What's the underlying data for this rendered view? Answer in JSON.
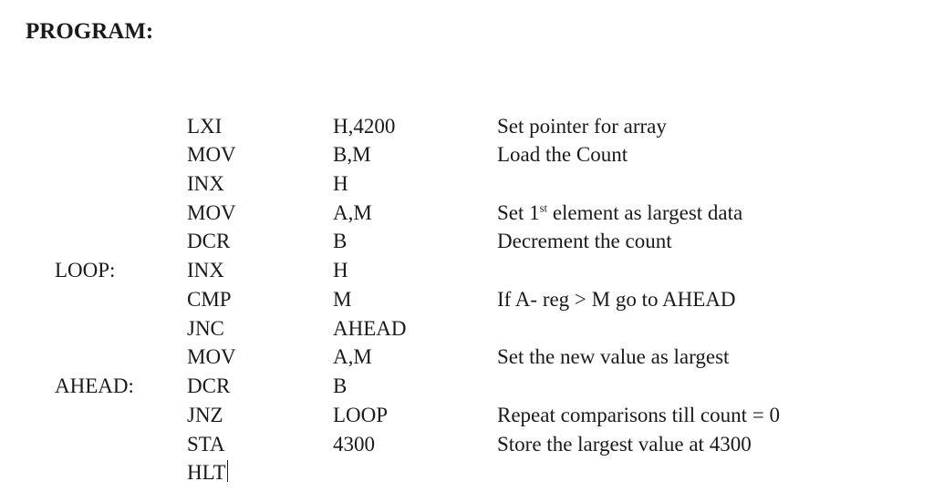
{
  "heading": "PROGRAM:",
  "program": {
    "rows": [
      {
        "label": "",
        "mnemonic": "LXI",
        "operand": "H,4200",
        "comment": "Set pointer for array"
      },
      {
        "label": "",
        "mnemonic": "MOV",
        "operand": "B,M",
        "comment": "Load the Count"
      },
      {
        "label": "",
        "mnemonic": "INX",
        "operand": "H",
        "comment": ""
      },
      {
        "label": "",
        "mnemonic": "MOV",
        "operand": "A,M",
        "comment_html": "Set 1<sup>st</sup> element as largest data"
      },
      {
        "label": "",
        "mnemonic": "DCR",
        "operand": "B",
        "comment": "Decrement the count"
      },
      {
        "label": "LOOP:",
        "mnemonic": "INX",
        "operand": "H",
        "comment": ""
      },
      {
        "label": "",
        "mnemonic": "CMP",
        "operand": "M",
        "comment": "If A- reg > M go to AHEAD"
      },
      {
        "label": "",
        "mnemonic": "JNC",
        "operand": "AHEAD",
        "comment": ""
      },
      {
        "label": "",
        "mnemonic": "MOV",
        "operand": "A,M",
        "comment": "Set the new value as largest"
      },
      {
        "label": "AHEAD:",
        "mnemonic": "DCR",
        "operand": "B",
        "comment": ""
      },
      {
        "label": "",
        "mnemonic": "JNZ",
        "operand": "LOOP",
        "comment": "Repeat comparisons till count = 0"
      },
      {
        "label": "",
        "mnemonic": "STA",
        "operand": "4300",
        "comment": "Store the largest value at 4300"
      },
      {
        "label": "",
        "mnemonic": "HLT",
        "operand": "",
        "comment": "",
        "cursor_after_mnemonic": true
      }
    ]
  }
}
